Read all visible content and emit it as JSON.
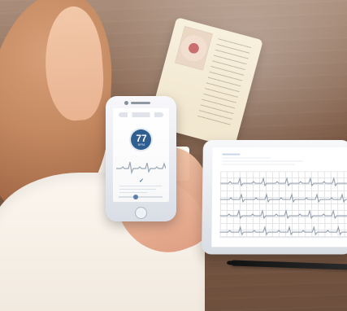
{
  "phone_ui": {
    "heart_rate_value": "77",
    "heart_rate_unit": "BPM",
    "check_icon": "check-icon"
  },
  "colors": {
    "heart_circle": "#2f5f90",
    "wave": "#9aa6b5",
    "accent": "#4b77a5"
  }
}
